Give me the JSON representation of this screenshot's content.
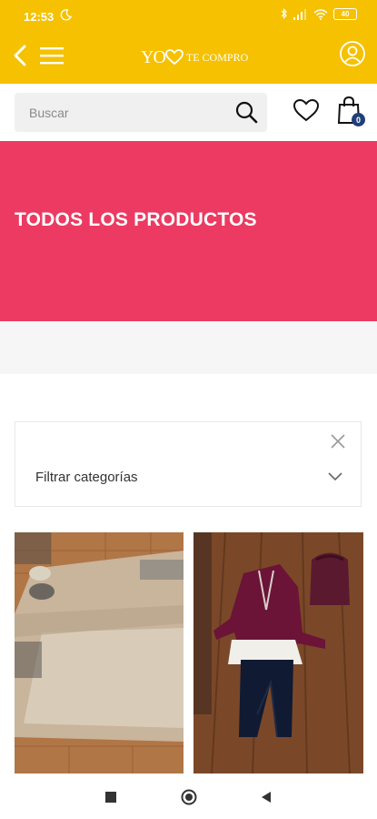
{
  "status_bar": {
    "time": "12:53",
    "battery": "40",
    "icons": [
      "moon-icon",
      "bluetooth-icon",
      "signal-icon",
      "wifi-icon",
      "battery-icon"
    ]
  },
  "header": {
    "logo_text_yo": "YO",
    "logo_text_tail": "TE COMPRO",
    "icons": [
      "back-arrow-icon",
      "hamburger-menu-icon",
      "heart-logo-icon",
      "user-icon"
    ]
  },
  "search": {
    "placeholder": "Buscar",
    "value": ""
  },
  "cart": {
    "count": "0"
  },
  "banner": {
    "title": "TODOS LOS PRODUCTOS"
  },
  "filter": {
    "label": "Filtrar categorías"
  },
  "products": [
    {
      "image": "product-photo-floor"
    },
    {
      "image": "product-photo-outfit"
    }
  ],
  "colors": {
    "brand_yellow": "#f5c100",
    "banner_pink": "#ec3a62",
    "badge_blue": "#1f3f7a"
  }
}
